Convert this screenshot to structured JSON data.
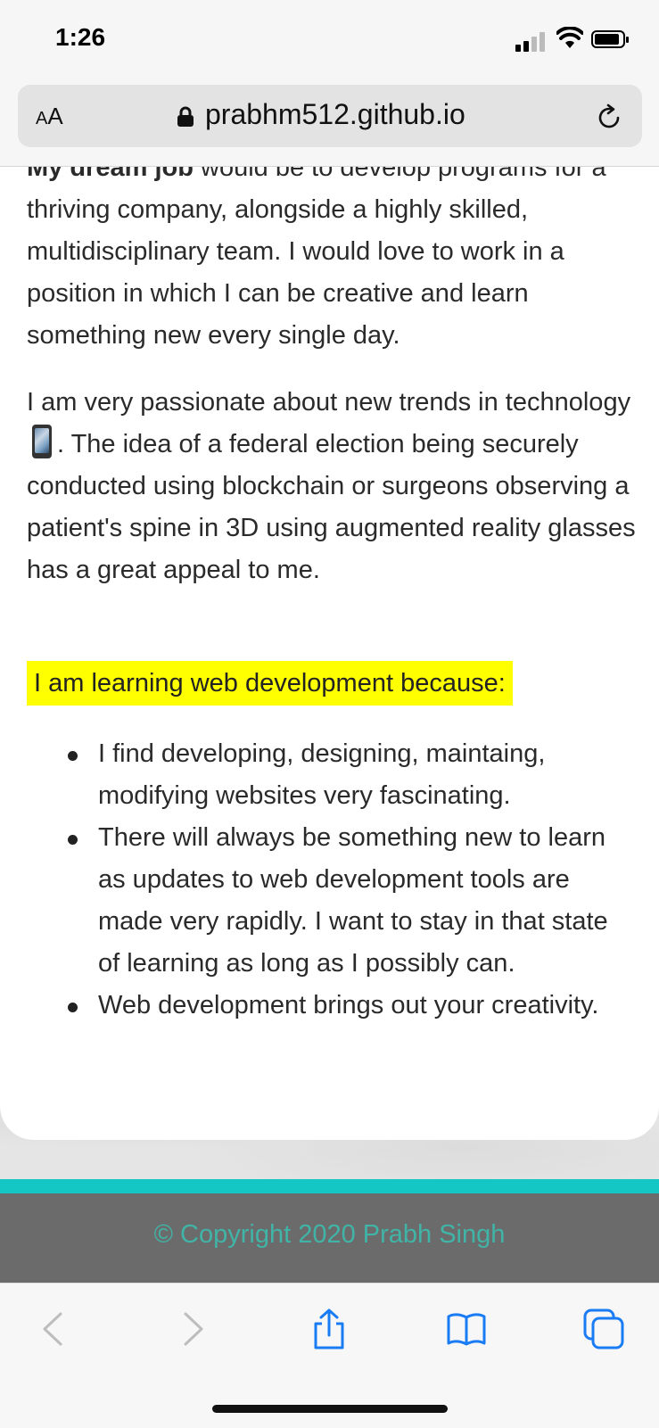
{
  "status_bar": {
    "time": "1:26"
  },
  "browser": {
    "text_size_label_small": "A",
    "text_size_label_large": "A",
    "url": "prabhm512.github.io"
  },
  "content": {
    "para1_bold": "My dream job",
    "para1_rest": " would be to develop programs for a thriving company, alongside a highly skilled, multidisciplinary team. I would love to work in a position in which I can be creative and learn something new every single day.",
    "para2_before": "I am very passionate about new trends in technology",
    "para2_after": ". The idea of a federal election being securely conducted using blockchain or surgeons observing a patient's spine in 3D using augmented reality glasses has a great appeal to me.",
    "highlight": "I am learning web development because:",
    "reasons": [
      "I find developing, designing, maintaing, modifying websites very fascinating.",
      "There will always be something new to learn as updates to web development tools are made very rapidly. I want to stay in that state of learning as long as I possibly can.",
      "Web development brings out your creativity."
    ]
  },
  "footer": {
    "copyright": "© Copyright 2020 Prabh Singh"
  },
  "colors": {
    "highlight": "#ffff00",
    "teal_bar": "#14c6c4",
    "footer_bg": "#6b6b6b",
    "footer_text": "#40b4a6",
    "toolbar_icon": "#1a7cf5"
  },
  "icons": [
    "phone-emoji",
    "lock-icon",
    "reload-icon",
    "back-icon",
    "forward-icon",
    "share-icon",
    "bookmarks-icon",
    "tabs-icon"
  ]
}
